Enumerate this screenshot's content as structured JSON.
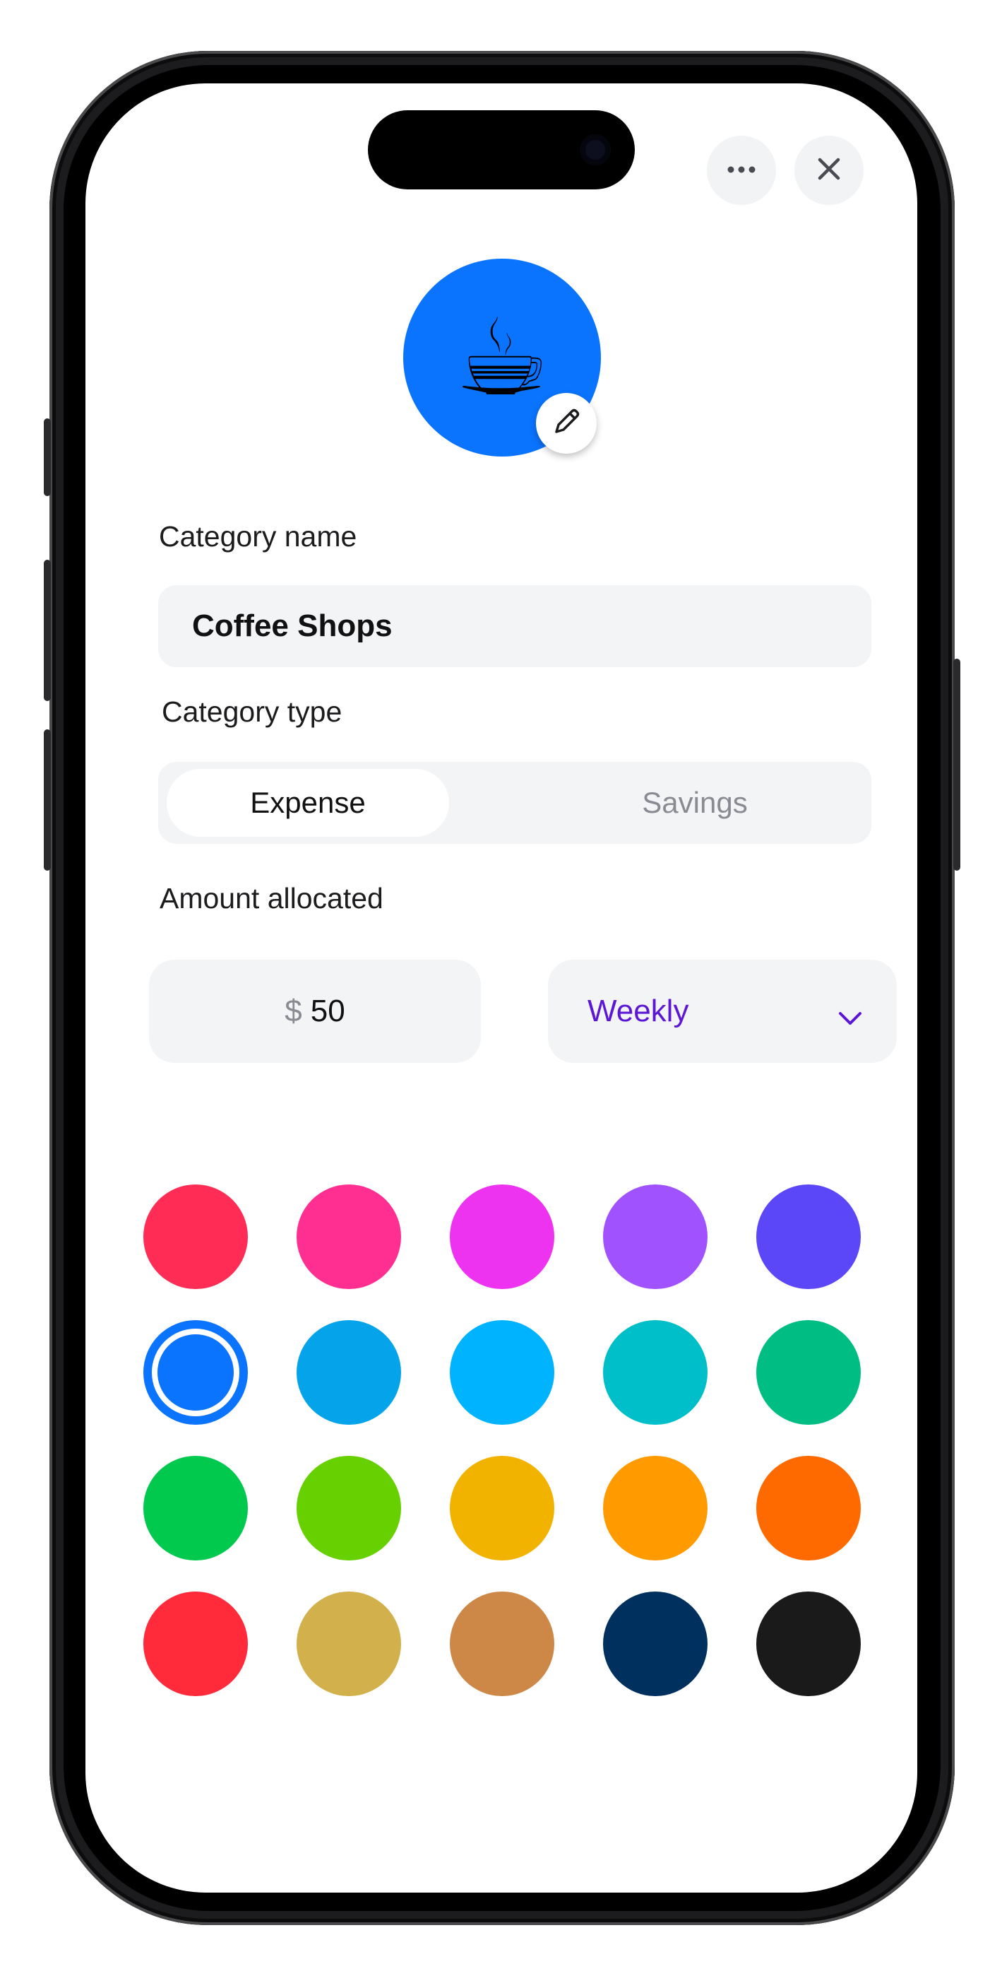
{
  "header": {
    "more_icon": "more-horizontal-icon",
    "close_icon": "close-icon"
  },
  "avatar": {
    "emoji": "☕",
    "background": "#0a74ff",
    "edit_icon": "pencil-icon"
  },
  "form": {
    "name_label": "Category name",
    "name_value": "Coffee Shops",
    "type_label": "Category  type",
    "type_options": [
      "Expense",
      "Savings"
    ],
    "type_selected": "Expense",
    "amount_label": "Amount allocated",
    "currency_symbol": "$",
    "amount_value": "50",
    "frequency_value": "Weekly",
    "frequency_icon": "chevron-down-icon"
  },
  "colors": {
    "selected": "#0a74ff",
    "swatches": [
      "#ff2d55",
      "#ff2f92",
      "#ee33f0",
      "#a052ff",
      "#5b47f7",
      "#0a74ff",
      "#05a4ea",
      "#00b3ff",
      "#00bfc9",
      "#00bd84",
      "#00c94d",
      "#66d000",
      "#f2b200",
      "#ff9a00",
      "#ff6a00",
      "#ff2a3a",
      "#d2b04c",
      "#cd8848",
      "#00305e",
      "#1a1a1a"
    ]
  }
}
